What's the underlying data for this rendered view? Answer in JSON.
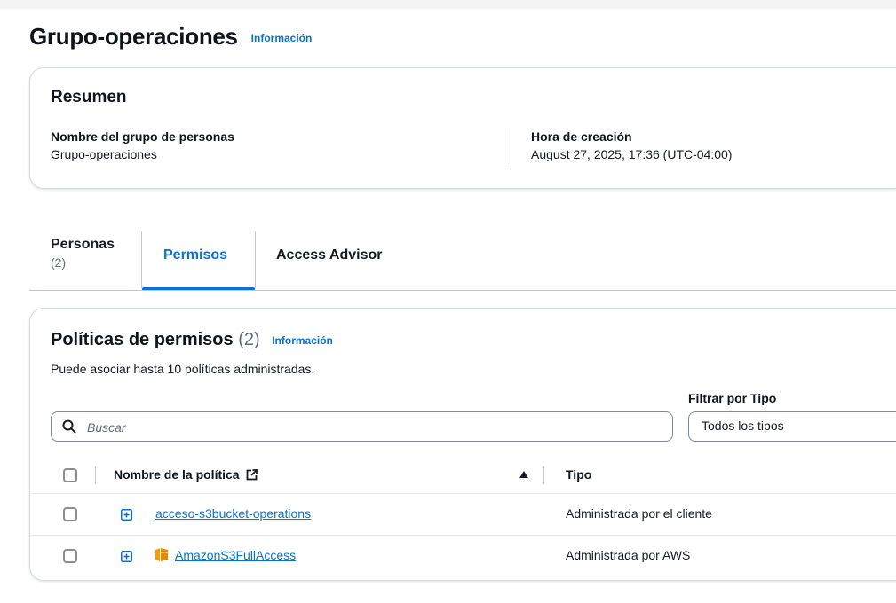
{
  "page": {
    "title": "Grupo-operaciones",
    "info_label": "Información"
  },
  "summary": {
    "title": "Resumen",
    "group_name_label": "Nombre del grupo de personas",
    "group_name_value": "Grupo-operaciones",
    "creation_label": "Hora de creación",
    "creation_value": "August 27, 2025, 17:36 (UTC-04:00)"
  },
  "tabs": [
    {
      "label": "Personas",
      "count": "(2)"
    },
    {
      "label": "Permisos",
      "active": true
    },
    {
      "label": "Access Advisor"
    }
  ],
  "permissions": {
    "title": "Políticas de permisos",
    "count": "(2)",
    "info_label": "Información",
    "description": "Puede asociar hasta 10 políticas administradas.",
    "filter_label": "Filtrar por Tipo",
    "filter_value": "Todos los tipos",
    "search_placeholder": "Buscar",
    "columns": [
      "Nombre de la política",
      "Tipo"
    ],
    "rows": [
      {
        "name": "acceso-s3bucket-operations",
        "type": "Administrada por el cliente",
        "icon": "none"
      },
      {
        "name": "AmazonS3FullAccess",
        "type": "Administrada por AWS",
        "icon": "aws-managed-icon"
      }
    ]
  },
  "colors": {
    "accent": "#0972d3",
    "text": "#16191f",
    "muted": "#5f6b7a",
    "border": "#c6c6cd",
    "aws_icon": "#ff9900"
  }
}
